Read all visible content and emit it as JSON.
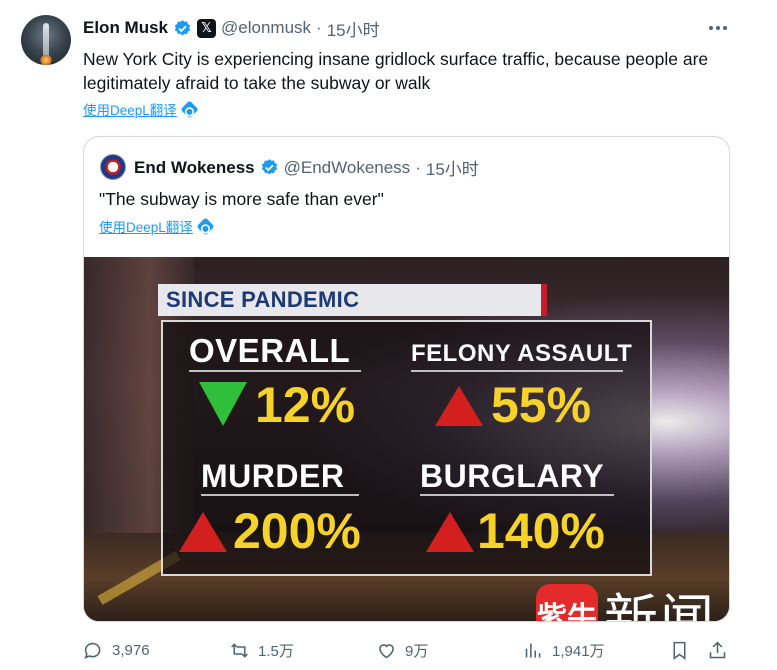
{
  "tweet": {
    "author_name": "Elon Musk",
    "handle": "@elonmusk",
    "separator": "·",
    "time": "15小时",
    "text": "New York City is experiencing insane gridlock surface traffic, because people are legitimately afraid to take the subway or walk",
    "translate_label": "使用DeepL翻译"
  },
  "quote": {
    "author_name": "End Wokeness",
    "handle": "@EndWokeness",
    "separator": "·",
    "time": "15小时",
    "text": "\"The subway is more safe than ever\"",
    "translate_label": "使用DeepL翻译",
    "media": {
      "banner": "SINCE PANDEMIC",
      "stats": [
        {
          "label": "OVERALL",
          "value": "12%",
          "direction": "down",
          "color": "#2fbf3a"
        },
        {
          "label": "FELONY ASSAULT",
          "value": "55%",
          "direction": "up",
          "color": "#d41f1f"
        },
        {
          "label": "MURDER",
          "value": "200%",
          "direction": "up",
          "color": "#d41f1f"
        },
        {
          "label": "BURGLARY",
          "value": "140%",
          "direction": "up",
          "color": "#d41f1f"
        }
      ],
      "watermark_logo": "紫牛",
      "watermark_text": "新闻"
    }
  },
  "actions": {
    "replies": "3,976",
    "reposts": "1.5万",
    "likes": "9万",
    "views": "1,941万"
  },
  "colors": {
    "accent": "#1d9bf0",
    "text": "#0f1419",
    "secondary": "#536471",
    "value_yellow": "#f6d22b"
  }
}
